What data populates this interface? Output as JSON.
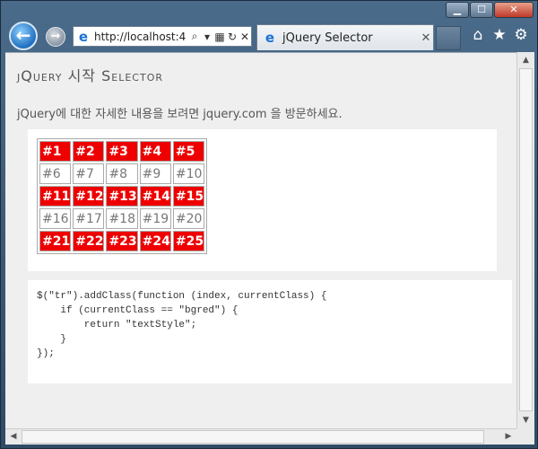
{
  "browser": {
    "address_url": "http://localhost:4",
    "tab_title": "jQuery Selector",
    "window_buttons": {
      "minimize": "▁",
      "maximize": "☐",
      "close": "✕"
    },
    "icons": [
      "back-icon",
      "forward-icon",
      "ie-icon",
      "search-icon",
      "dropdown-icon",
      "compat-icon",
      "refresh-icon",
      "stop-icon",
      "home-icon",
      "favorites-icon",
      "settings-icon"
    ]
  },
  "page": {
    "title": "jQuery 시작 Selector",
    "intro": "jQuery에 대한 자세한 내용을 보려면 jquery.com 을 방문하세요."
  },
  "grid": {
    "rows": [
      {
        "style": "red",
        "cells": [
          "#1",
          "#2",
          "#3",
          "#4",
          "#5"
        ]
      },
      {
        "style": "plain",
        "cells": [
          "#6",
          "#7",
          "#8",
          "#9",
          "#10"
        ]
      },
      {
        "style": "red",
        "cells": [
          "#11",
          "#12",
          "#13",
          "#14",
          "#15"
        ]
      },
      {
        "style": "plain",
        "cells": [
          "#16",
          "#17",
          "#18",
          "#19",
          "#20"
        ]
      },
      {
        "style": "red",
        "cells": [
          "#21",
          "#22",
          "#23",
          "#24",
          "#25"
        ]
      }
    ],
    "colors": {
      "red_bg": "#ee0000",
      "red_text": "#ffffff",
      "plain_text": "#777777"
    }
  },
  "code": {
    "lines": [
      "$(\"tr\").addClass(function (index, currentClass) {",
      "    if (currentClass == \"bgred\") {",
      "        return \"textStyle\";",
      "    }",
      "});"
    ]
  }
}
